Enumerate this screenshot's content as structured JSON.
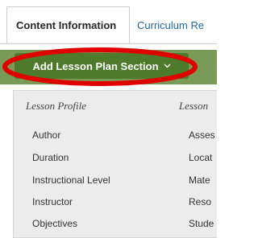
{
  "tabs": {
    "active_label": "Content Information",
    "next_label": "Curriculum Re"
  },
  "action": {
    "button_label": "Add Lesson Plan Section",
    "chevron_icon": "chevron-down-icon",
    "annotation_color": "#e10000"
  },
  "dropdown": {
    "left_heading": "Lesson Profile",
    "right_heading": "Lesson",
    "left_items": [
      "Author",
      "Duration",
      "Instructional Level",
      "Instructor",
      "Objectives"
    ],
    "right_items": [
      "Asses",
      "Locat",
      "Mate",
      "Reso",
      "Stude"
    ]
  }
}
